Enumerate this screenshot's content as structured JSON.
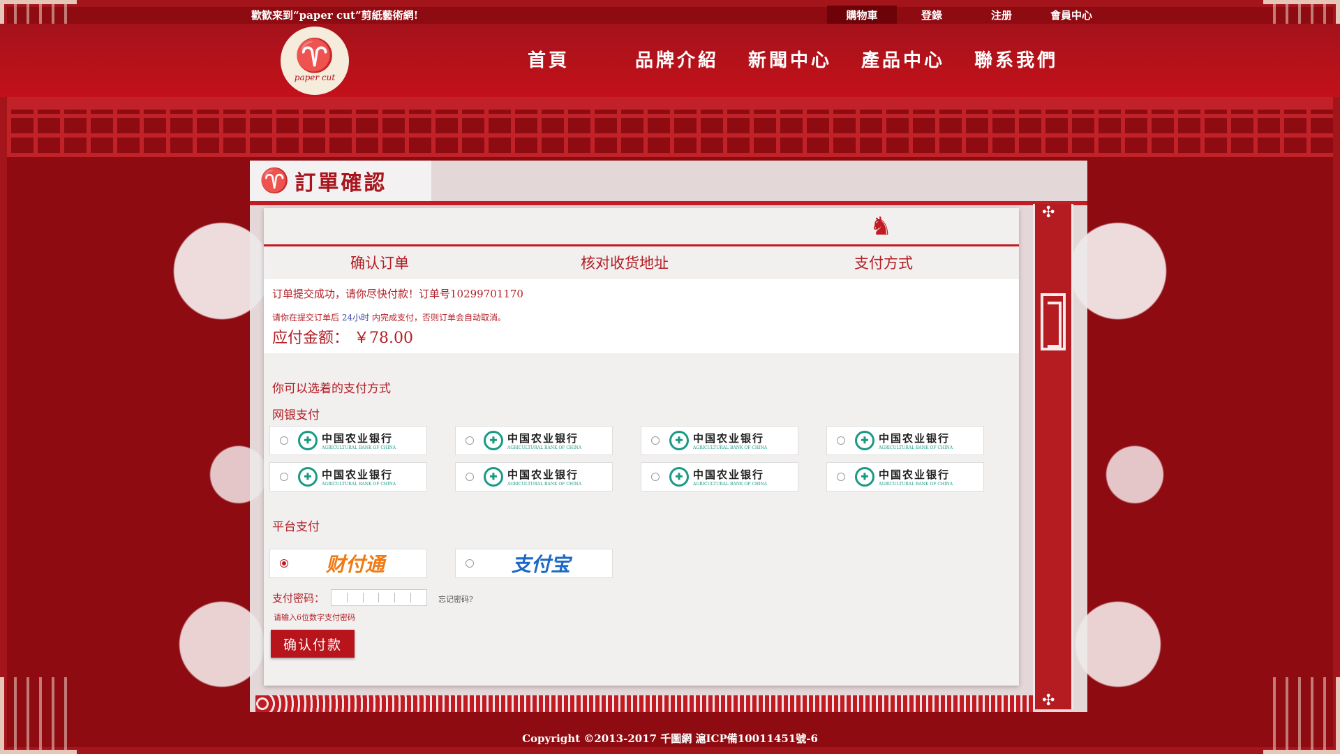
{
  "topbar": {
    "welcome": "歡歓来到“paper cut”剪紙藝術網!",
    "links": [
      "購物車",
      "登錄",
      "注册",
      "會員中心"
    ]
  },
  "logo": {
    "brand": "paper cut"
  },
  "nav": [
    "首頁",
    "品牌介紹",
    "新聞中心",
    "產品中心",
    "聯系我們"
  ],
  "page_title": "訂單確認",
  "steps": [
    "确认订单",
    "核对收货地址",
    "支付方式"
  ],
  "order": {
    "success_text": "订单提交成功，请你尽快付款！订单号10299701170",
    "notice_prefix": "请你在提交订单后",
    "notice_hours": "24小时",
    "notice_suffix": "内完成支付，否则订单会自动取消。",
    "amount_label": "应付金额：",
    "amount_value": "￥78.00"
  },
  "payment": {
    "tip": "你可以选着的支付方式",
    "netbank_label": "网银支付",
    "bank_name_cn": "中国农业银行",
    "bank_name_en": "AGRICULTURAL BANK OF CHINA",
    "platform_label": "平台支付",
    "tenpay": "财付通",
    "alipay": "支付宝",
    "password_label": "支付密码：",
    "forgot": "忘记密码?",
    "password_hint": "请输入6位数字支付密码",
    "confirm_button": "确认付款"
  },
  "footer": "Copyright ©2013-2017 千圖網 滬ICP備10011451號-6",
  "colors": {
    "primary": "#b7141c",
    "background": "#8e0b12",
    "bank_green": "#1a9a85"
  }
}
